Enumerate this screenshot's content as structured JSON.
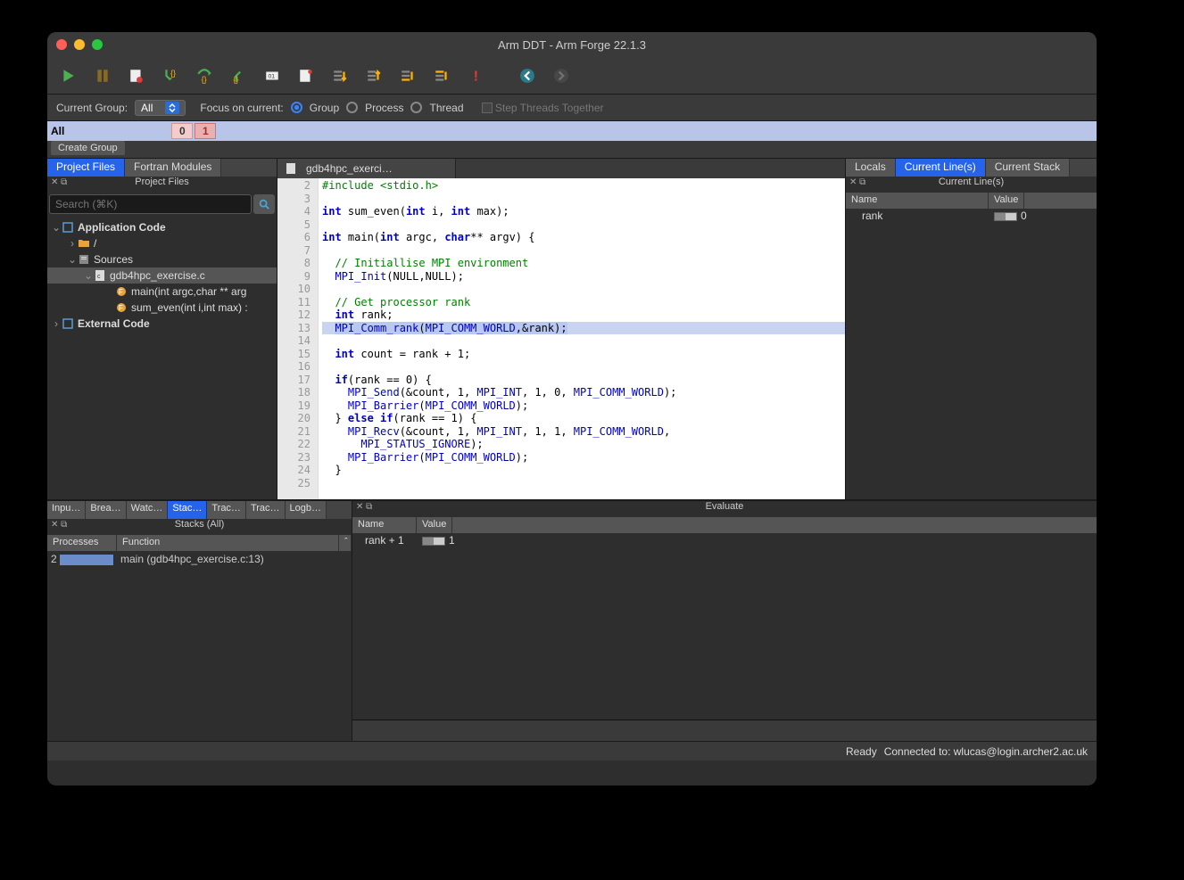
{
  "window": {
    "title": "Arm DDT - Arm Forge 22.1.3"
  },
  "groupbar": {
    "label": "Current Group:",
    "select": "All",
    "focus_label": "Focus on current:",
    "radios": {
      "group": "Group",
      "process": "Process",
      "thread": "Thread"
    },
    "step_check": "Step Threads Together"
  },
  "procbar": {
    "label": "All",
    "procs": [
      "0",
      "1"
    ]
  },
  "create_group": "Create Group",
  "left_tabs": {
    "project": "Project Files",
    "fortran": "Fortran Modules"
  },
  "left_header": "Project Files",
  "search_placeholder": "Search (⌘K)",
  "tree": {
    "app": "Application Code",
    "root": "/",
    "sources": "Sources",
    "file": "gdb4hpc_exercise.c",
    "fn_main": "main(int argc,char ** arg",
    "fn_sum": "sum_even(int i,int max) :",
    "external": "External Code"
  },
  "editor_tab": "gdb4hpc_exerci…",
  "code": {
    "lines": [
      {
        "n": 2,
        "html": "<span class='pp'>#include</span> <span class='st'>&lt;stdio.h&gt;</span>"
      },
      {
        "n": 3,
        "html": ""
      },
      {
        "n": 4,
        "html": "<span class='ty'>int</span> sum_even(<span class='ty'>int</span> i, <span class='ty'>int</span> max);"
      },
      {
        "n": 5,
        "html": ""
      },
      {
        "n": 6,
        "html": "<span class='ty'>int</span> main(<span class='ty'>int</span> argc, <span class='ty'>char</span>** argv) {"
      },
      {
        "n": 7,
        "html": ""
      },
      {
        "n": 8,
        "html": "  <span class='cm'>// Initiallise MPI environment</span>"
      },
      {
        "n": 9,
        "html": "  <span class='fn'>MPI_Init</span>(NULL,NULL);"
      },
      {
        "n": 10,
        "html": ""
      },
      {
        "n": 11,
        "html": "  <span class='cm'>// Get processor rank</span>"
      },
      {
        "n": 12,
        "html": "  <span class='ty'>int</span> rank;"
      },
      {
        "n": 13,
        "cur": true,
        "html": "  <span class='hl'><span class='fn'>MPI_Comm_rank</span>(<span class='fn'>MPI_COMM_WORLD</span>,&amp;rank);</span>"
      },
      {
        "n": 14,
        "html": ""
      },
      {
        "n": 15,
        "html": "  <span class='ty'>int</span> count = rank + 1;"
      },
      {
        "n": 16,
        "html": ""
      },
      {
        "n": 17,
        "html": "  <span class='kw'>if</span>(rank == 0) {"
      },
      {
        "n": 18,
        "html": "    <span class='fn'>MPI_Send</span>(&amp;count, 1, <span class='fn'>MPI_INT</span>, 1, 0, <span class='fn'>MPI_COMM_WORLD</span>);"
      },
      {
        "n": 19,
        "html": "    <span class='fn'>MPI_Barrier</span>(<span class='fn'>MPI_COMM_WORLD</span>);"
      },
      {
        "n": 20,
        "html": "  } <span class='kw'>else</span> <span class='kw'>if</span>(rank == 1) {"
      },
      {
        "n": 21,
        "html": "    <span class='fn'>MPI_Recv</span>(&amp;count, 1, <span class='fn'>MPI_INT</span>, 1, 1, <span class='fn'>MPI_COMM_WORLD</span>,"
      },
      {
        "n": 22,
        "html": "      <span class='fn'>MPI_STATUS_IGNORE</span>);"
      },
      {
        "n": 23,
        "html": "    <span class='fn'>MPI_Barrier</span>(<span class='fn'>MPI_COMM_WORLD</span>);"
      },
      {
        "n": 24,
        "html": "  }"
      },
      {
        "n": 25,
        "html": ""
      }
    ]
  },
  "right_tabs": {
    "locals": "Locals",
    "lines": "Current Line(s)",
    "stack": "Current Stack"
  },
  "right_header": "Current Line(s)",
  "right_cols": {
    "name": "Name",
    "value": "Value"
  },
  "right_rows": [
    {
      "name": "rank",
      "value": "0"
    }
  ],
  "bottom_tabs": [
    "Inpu…",
    "Brea…",
    "Watc…",
    "Stac…",
    "Trac…",
    "Trac…",
    "Logb…"
  ],
  "bottom_active": 3,
  "stacks_header": "Stacks (All)",
  "stacks_cols": {
    "proc": "Processes",
    "func": "Function"
  },
  "stacks_rows": [
    {
      "proc": "2",
      "func": "main (gdb4hpc_exercise.c:13)"
    }
  ],
  "eval_header": "Evaluate",
  "eval_cols": {
    "name": "Name",
    "value": "Value"
  },
  "eval_rows": [
    {
      "name": "rank + 1",
      "value": "1"
    }
  ],
  "status": {
    "ready": "Ready",
    "conn": "Connected to: wlucas@login.archer2.ac.uk"
  }
}
